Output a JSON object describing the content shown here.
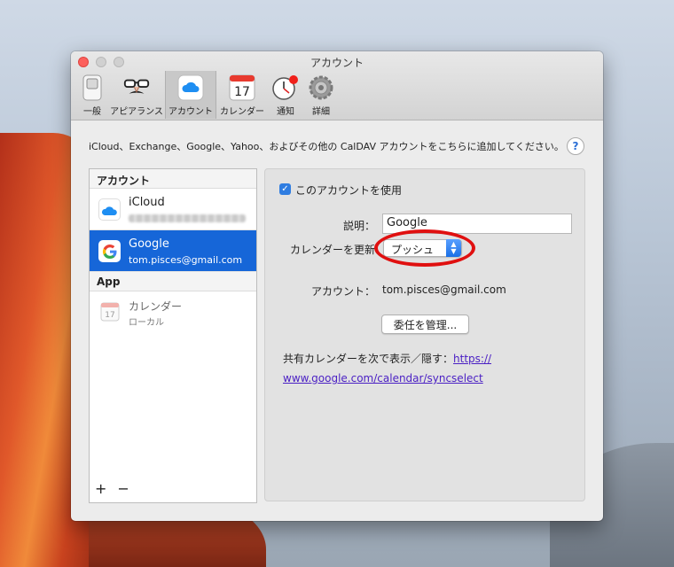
{
  "window": {
    "title": "アカウント"
  },
  "toolbar": {
    "tabs": [
      {
        "label": "一般",
        "icon": "switch-icon"
      },
      {
        "label": "アピアランス",
        "icon": "disguise-icon"
      },
      {
        "label": "アカウント",
        "icon": "cloud-icon",
        "active": true
      },
      {
        "label": "カレンダー",
        "icon": "calendar-icon",
        "day": "17"
      },
      {
        "label": "通知",
        "icon": "clock-icon"
      },
      {
        "label": "詳細",
        "icon": "gear-icon"
      }
    ]
  },
  "description": "iCloud、Exchange、Google、Yahoo、およびその他の CalDAV アカウントをこちらに追加してください。",
  "help_label": "?",
  "sidebar": {
    "accounts_header": "アカウント",
    "accounts": [
      {
        "name": "iCloud",
        "sub": "",
        "icon": "icloud-icon"
      },
      {
        "name": "Google",
        "sub": "tom.pisces@gmail.com",
        "icon": "google-icon",
        "selected": true
      }
    ],
    "app_header": "App",
    "app_items": [
      {
        "name": "カレンダー",
        "sub": "ローカル",
        "icon": "calendar-icon",
        "day": "17"
      }
    ],
    "add_label": "+",
    "remove_label": "−"
  },
  "detail": {
    "enable_label": "このアカウントを使用",
    "enable_checked": true,
    "description_label": "説明：",
    "description_value": "Google",
    "refresh_label": "カレンダーを更新",
    "refresh_value": "プッシュ",
    "account_label": "アカウント：",
    "account_value": "tom.pisces@gmail.com",
    "delegation_button": "委任を管理...",
    "shared_text": "共有カレンダーを次で表示／隠す：",
    "shared_link_part1": "https://",
    "shared_link_part2": "www.google.com/calendar/syncselect"
  },
  "colors": {
    "accent": "#1666d8",
    "highlight": "#e01010"
  }
}
